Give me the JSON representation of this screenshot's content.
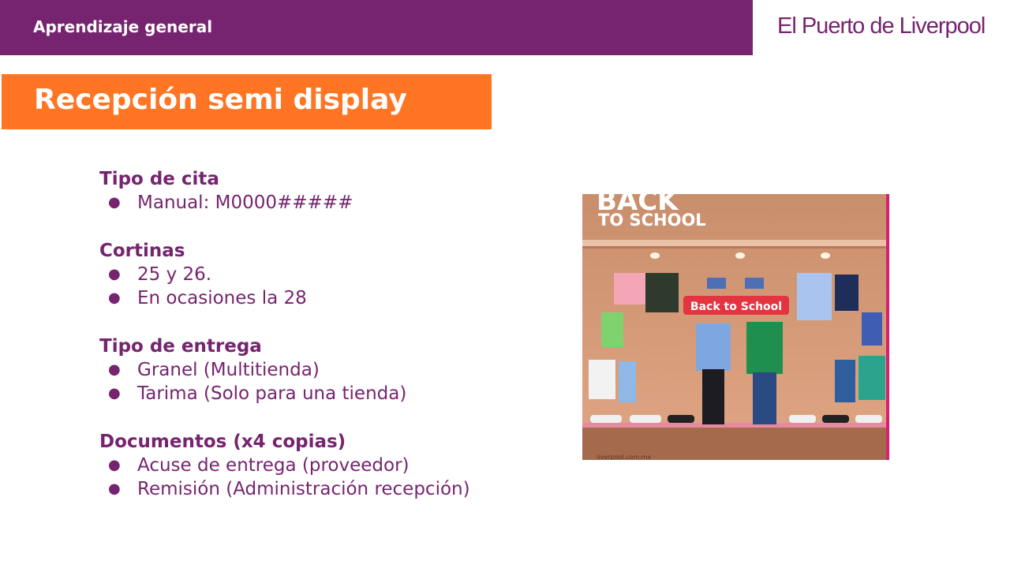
{
  "header": {
    "title": "Aprendizaje general",
    "brand": "El Puerto de Liverpool"
  },
  "slide": {
    "title": "Recepción semi display"
  },
  "sections": [
    {
      "title": "Tipo de cita",
      "items": [
        "Manual: M0000#####"
      ]
    },
    {
      "title": "Cortinas",
      "items": [
        "25 y 26.",
        "En ocasiones la 28"
      ]
    },
    {
      "title": "Tipo de entrega",
      "items": [
        "Granel (Multitienda)",
        "Tarima (Solo para una tienda)"
      ]
    },
    {
      "title": "Documentos (x4 copias)",
      "items": [
        "Acuse de entrega (proveedor)",
        "Remisión (Administración recepción)"
      ]
    }
  ],
  "photo": {
    "headline_1": "BACK",
    "headline_2": "TO SCHOOL",
    "sign": "Back to School",
    "footer": "liverpool.com.mx"
  },
  "colors": {
    "purple": "#76246f",
    "orange": "#ff7523"
  }
}
